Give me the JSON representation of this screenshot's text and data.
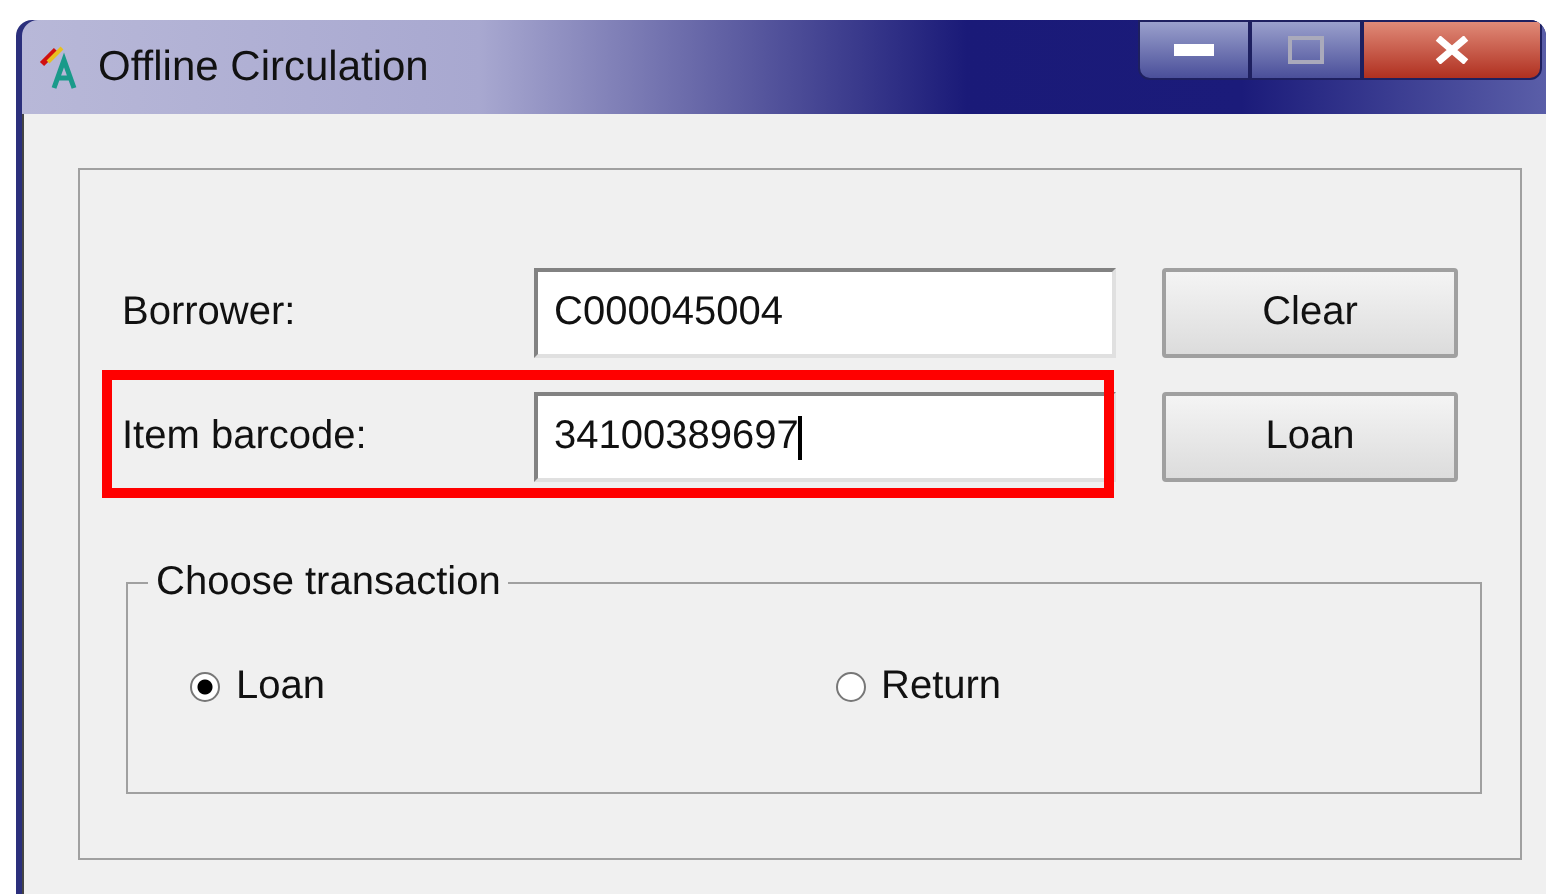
{
  "window": {
    "title": "Offline Circulation"
  },
  "fields": [
    {
      "label": "Borrower:",
      "value": "C000045004",
      "focused": false,
      "highlighted": false,
      "button": "Clear"
    },
    {
      "label": "Item barcode:",
      "value": "34100389697",
      "focused": true,
      "highlighted": true,
      "button": "Loan"
    }
  ],
  "transaction": {
    "legend": "Choose transaction",
    "options": [
      {
        "label": "Loan",
        "selected": true
      },
      {
        "label": "Return",
        "selected": false
      }
    ]
  }
}
